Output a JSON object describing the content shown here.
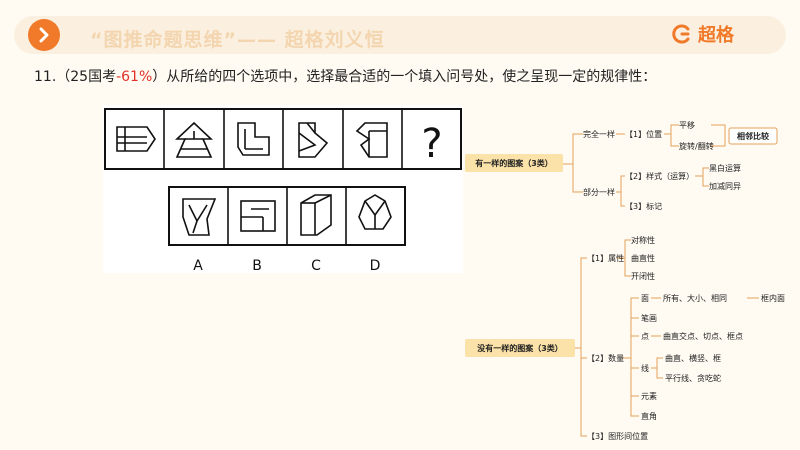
{
  "header": {
    "title": "“图推命题思维”—— 超格刘义恒",
    "brand": "超格",
    "accent_color": "#f07a2a",
    "arrow_icon": "chevron-right-icon"
  },
  "question": {
    "number": "11.",
    "prefix": "（25国考",
    "rate": "-61%",
    "suffix": "）从所给的四个选项中，选择最合适的一个填入问号处，使之呈现一定的规律性："
  },
  "puzzle": {
    "question_mark": "?",
    "options": [
      "A",
      "B",
      "C",
      "D"
    ]
  },
  "mindmap": {
    "same_pattern": {
      "root": "有一样的图案（3类）",
      "full_same": "完全一样",
      "position": "【1】位置",
      "translate": "平移",
      "rotate_flip": "旋转/翻转",
      "adjacent": "相邻比较",
      "partial_same": "部分一样",
      "style": "【2】样式（运算）",
      "bw_calc": "黑白运算",
      "add_sub": "加减同异",
      "mark": "【3】标记"
    },
    "no_pattern": {
      "root": "没有一样的图案（3类）",
      "attr": "【1】属性",
      "symmetry": "对称性",
      "curvature": "曲直性",
      "openness": "开闭性",
      "count": "【2】数量",
      "face": "面",
      "face_detail": "所有、大小、相同",
      "inner_face": "框内面",
      "stroke": "笔画",
      "point": "点",
      "point_detail": "曲直交点、切点、框点",
      "line": "线",
      "line_detail1": "曲直、横竖、框",
      "line_detail2": "平行线、贪吃蛇",
      "element": "元素",
      "right_angle": "直角",
      "relation": "【3】图形间位置"
    }
  }
}
